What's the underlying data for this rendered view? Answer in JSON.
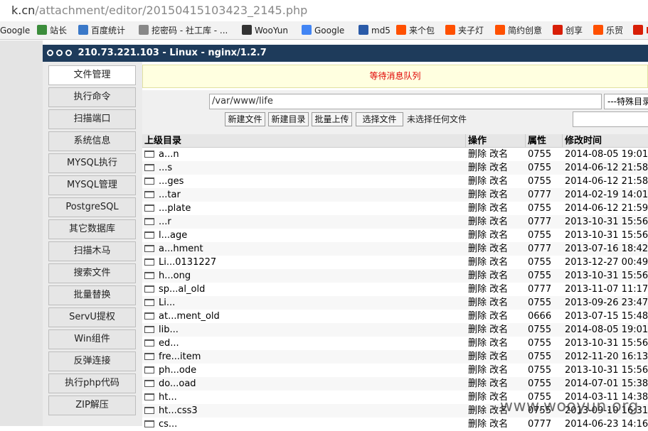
{
  "browser": {
    "url_main": "k.cn",
    "url_path": "/attachment/editor/20150415103423_2145.php",
    "bookmarks": [
      {
        "label": "Google",
        "icon": "google-icon",
        "color": "#4285f4"
      },
      {
        "label": "站长",
        "icon": "zhanzhang-icon",
        "color": "#3b8d3b"
      },
      {
        "label": "百度统计",
        "icon": "chart-icon",
        "color": "#3a78c8"
      },
      {
        "label": "挖密码 - 社工库 - ...",
        "icon": "page-icon",
        "color": "#888888"
      },
      {
        "label": "WooYun",
        "icon": "wooyun-icon",
        "color": "#333333"
      },
      {
        "label": "Google",
        "icon": "google-g-icon",
        "color": "#4285f4"
      },
      {
        "label": "md5",
        "icon": "grid-icon",
        "color": "#2a5aa8"
      },
      {
        "label": "来个包",
        "icon": "taobao-icon",
        "color": "#ff5000"
      },
      {
        "label": "夹子灯",
        "icon": "taobao-icon",
        "color": "#ff5000"
      },
      {
        "label": "简约创意",
        "icon": "taobao-icon",
        "color": "#ff5000"
      },
      {
        "label": "创享",
        "icon": "t-icon",
        "color": "#d81e06"
      },
      {
        "label": "乐贸",
        "icon": "taobao-icon",
        "color": "#ff5000"
      },
      {
        "label": "N",
        "icon": "n-icon",
        "color": "#d81e06"
      }
    ]
  },
  "panel": {
    "title": "210.73.221.103 - Linux - nginx/1.2.7"
  },
  "sidebar": {
    "items": [
      {
        "label": "文件管理"
      },
      {
        "label": "执行命令"
      },
      {
        "label": "扫描端口"
      },
      {
        "label": "系统信息"
      },
      {
        "label": "MYSQL执行"
      },
      {
        "label": "MYSQL管理"
      },
      {
        "label": "PostgreSQL"
      },
      {
        "label": "其它数据库"
      },
      {
        "label": "扫描木马"
      },
      {
        "label": "搜索文件"
      },
      {
        "label": "批量替换"
      },
      {
        "label": "ServU提权"
      },
      {
        "label": "Win组件"
      },
      {
        "label": "反弹连接"
      },
      {
        "label": "执行php代码"
      },
      {
        "label": "ZIP解压"
      }
    ]
  },
  "main": {
    "message": "等待消息队列",
    "path_value": "/var/www/life",
    "special_dir": "---特殊目录",
    "buttons": {
      "new_file": "新建文件",
      "new_dir": "新建目录",
      "batch_upload": "批量上传",
      "choose_file": "选择文件"
    },
    "no_file": "未选择任何文件",
    "table": {
      "headers": [
        "上级目录",
        "操作",
        "属性",
        "修改时间"
      ],
      "rows": [
        {
          "name": "a...n",
          "ops": "删除 改名",
          "perm": "0755",
          "time": "2014-08-05 19:01"
        },
        {
          "name": "...s",
          "ops": "删除 改名",
          "perm": "0755",
          "time": "2014-06-12 21:58"
        },
        {
          "name": "...ges",
          "ops": "删除 改名",
          "perm": "0755",
          "time": "2014-06-12 21:58"
        },
        {
          "name": "...tar",
          "ops": "删除 改名",
          "perm": "0777",
          "time": "2014-02-19 14:01"
        },
        {
          "name": "...plate",
          "ops": "删除 改名",
          "perm": "0755",
          "time": "2014-06-12 21:59"
        },
        {
          "name": "...r",
          "ops": "删除 改名",
          "perm": "0777",
          "time": "2013-10-31 15:56"
        },
        {
          "name": "l...age",
          "ops": "删除 改名",
          "perm": "0755",
          "time": "2013-10-31 15:56"
        },
        {
          "name": "a...hment",
          "ops": "删除 改名",
          "perm": "0777",
          "time": "2013-07-16 18:42"
        },
        {
          "name": "Li...0131227",
          "ops": "删除 改名",
          "perm": "0755",
          "time": "2013-12-27 00:49"
        },
        {
          "name": "h...ong",
          "ops": "删除 改名",
          "perm": "0755",
          "time": "2013-10-31 15:56"
        },
        {
          "name": "sp...al_old",
          "ops": "删除 改名",
          "perm": "0777",
          "time": "2013-11-07 11:17"
        },
        {
          "name": "Li...",
          "ops": "删除 改名",
          "perm": "0755",
          "time": "2013-09-26 23:47"
        },
        {
          "name": "at...ment_old",
          "ops": "删除 改名",
          "perm": "0666",
          "time": "2013-07-15 15:48"
        },
        {
          "name": "lib...",
          "ops": "删除 改名",
          "perm": "0755",
          "time": "2014-08-05 19:01"
        },
        {
          "name": "ed...",
          "ops": "删除 改名",
          "perm": "0755",
          "time": "2013-10-31 15:56"
        },
        {
          "name": "fre...item",
          "ops": "删除 改名",
          "perm": "0755",
          "time": "2012-11-20 16:13"
        },
        {
          "name": "ph...ode",
          "ops": "删除 改名",
          "perm": "0755",
          "time": "2013-10-31 15:56"
        },
        {
          "name": "do...oad",
          "ops": "删除 改名",
          "perm": "0755",
          "time": "2014-07-01 15:38"
        },
        {
          "name": "ht...",
          "ops": "删除 改名",
          "perm": "0755",
          "time": "2014-03-11 14:38"
        },
        {
          "name": "ht...css3",
          "ops": "删除 改名",
          "perm": "0755",
          "time": "2013-09-10 16:31"
        },
        {
          "name": "cs...",
          "ops": "删除 改名",
          "perm": "0777",
          "time": "2014-06-23 14:16"
        }
      ]
    }
  },
  "watermark": "www.wooyun.org"
}
